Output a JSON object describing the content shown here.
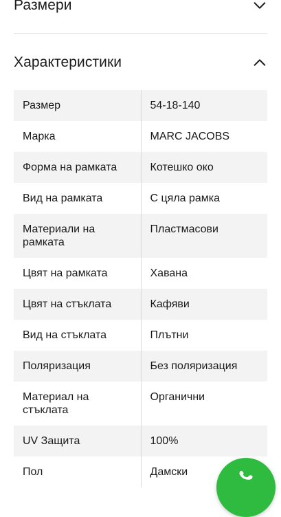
{
  "sections": {
    "sizes": {
      "title": "Размери",
      "expanded": false
    },
    "specs": {
      "title": "Характеристики",
      "expanded": true
    }
  },
  "spec_rows": [
    {
      "key": "Размер",
      "value": "54-18-140"
    },
    {
      "key": "Марка",
      "value": "MARC JACOBS"
    },
    {
      "key": "Форма на рамката",
      "value": "Котешко око"
    },
    {
      "key": "Вид на рамката",
      "value": "С цяла рамка"
    },
    {
      "key": "Материали на рамката",
      "value": "Пластмасови"
    },
    {
      "key": "Цвят на рамката",
      "value": "Хавана"
    },
    {
      "key": "Цвят на стъклата",
      "value": "Кафяви"
    },
    {
      "key": "Вид на стъклата",
      "value": "Плътни"
    },
    {
      "key": "Поляризация",
      "value": "Без поляризация"
    },
    {
      "key": "Материал на стъклата",
      "value": "Органични"
    },
    {
      "key": "UV Защита",
      "value": "100%"
    },
    {
      "key": "Пол",
      "value": "Дамски"
    }
  ],
  "fab": {
    "icon": "phone-icon",
    "color": "#2fbb3f"
  }
}
